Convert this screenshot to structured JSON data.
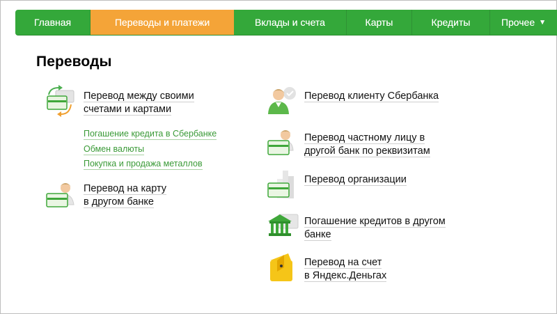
{
  "nav": {
    "items": [
      {
        "label": "Главная"
      },
      {
        "label": "Переводы и платежи"
      },
      {
        "label": "Вклады и счета"
      },
      {
        "label": "Карты"
      },
      {
        "label": "Кредиты"
      },
      {
        "label": "Прочее"
      }
    ],
    "active": "Переводы и платежи",
    "more_icon": "chevron-down-icon"
  },
  "page": {
    "title": "Переводы"
  },
  "left": {
    "own_transfer": {
      "line1": "Перевод между своими",
      "line2": "счетами и картами"
    },
    "sublinks": [
      "Погашение кредита в Сбербанке",
      "Обмен валюты",
      "Покупка и продажа металлов"
    ],
    "card_other_bank": {
      "line1": "Перевод на карту",
      "line2": "в другом банке"
    }
  },
  "right": {
    "client": {
      "line1": "Перевод клиенту Сбербанка"
    },
    "private": {
      "line1": "Перевод частному лицу в",
      "line2": "другой банк по реквизитам"
    },
    "org": {
      "line1": "Перевод организации"
    },
    "loans": {
      "line1": "Погашение кредитов в другом",
      "line2": "банке"
    },
    "yandex": {
      "line1": "Перевод на счет",
      "line2": "в Яндекс.Деньгах"
    }
  },
  "colors": {
    "nav_green": "#34a83a",
    "nav_active": "#f4a438",
    "link_green": "#3a9a37",
    "yandex_yellow": "#f5c518"
  }
}
